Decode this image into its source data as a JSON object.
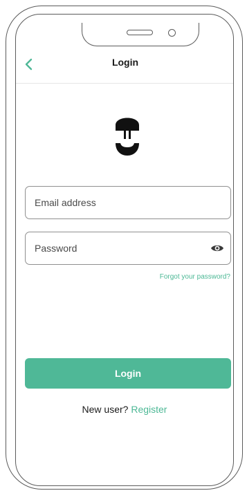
{
  "header": {
    "title": "Login",
    "back_icon": "chevron-left-icon"
  },
  "logo": {
    "icon": "brand-logo-icon"
  },
  "form": {
    "email_placeholder": "Email address",
    "email_value": "",
    "password_placeholder": "Password",
    "password_value": "",
    "password_toggle_icon": "eye-icon",
    "forgot_password_label": "Forgot your password?",
    "login_label": "Login"
  },
  "register": {
    "prompt": "New user?",
    "link_label": "Register"
  },
  "colors": {
    "accent": "#4fb897",
    "accent_text": "#4cb895",
    "text": "#1a1a1a",
    "border": "#8f8f8f"
  }
}
